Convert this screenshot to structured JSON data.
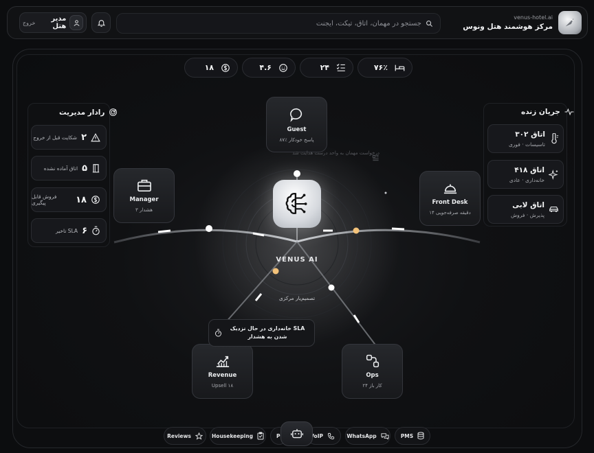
{
  "header": {
    "brand_sub": "venus-hotel.ai",
    "brand_title": "مرکز هوشمند هتل ونوس",
    "search_placeholder": "جستجو در مهمان، اتاق، تیکت، ایجنت",
    "user_name": "مدیر هتل",
    "logout_label": "خروج"
  },
  "stats": [
    {
      "value": "۷۶٪",
      "icon": "bed-icon"
    },
    {
      "value": "۲۴",
      "icon": "checklist-icon"
    },
    {
      "value": "۴.۶",
      "icon": "smile-icon"
    },
    {
      "value": "۱۸",
      "icon": "dollar-icon"
    }
  ],
  "radar": {
    "title": "رادار مدیریت",
    "items": [
      {
        "num": "۲",
        "label": "شکایت قبل از خروج",
        "icon": "warning-icon"
      },
      {
        "num": "۵",
        "label": "اتاق آماده نشده",
        "icon": "door-icon"
      },
      {
        "num": "۱۸",
        "label": "فروش قابل پیگیری",
        "icon": "dollar-icon"
      },
      {
        "num": "۶",
        "label": "تاخیر SLA",
        "icon": "timer-icon"
      }
    ]
  },
  "live": {
    "title": "جریان زنده",
    "items": [
      {
        "title": "اتاق ۳۰۲",
        "sub": "تاسیسات · فوری",
        "icon": "thermometer-icon"
      },
      {
        "title": "اتاق ۴۱۸",
        "sub": "خانه‌داری · عادی",
        "icon": "sparkle-icon"
      },
      {
        "title": "اتاق لابی",
        "sub": "پذیرش · فروش",
        "icon": "car-icon"
      }
    ]
  },
  "nodes": {
    "guest": {
      "name": "Guest",
      "sub": "۸۷٪ پاسخ خودکار"
    },
    "manager": {
      "name": "Manager",
      "sub": "۳ هشدار"
    },
    "frontdesk": {
      "name": "Front Desk",
      "sub": "۱۴ دقیقه صرفه‌جویی"
    },
    "revenue": {
      "name": "Revenue",
      "sub": "Upsell ۱۸"
    },
    "ops": {
      "name": "Ops",
      "sub": "۲۴ کار باز"
    }
  },
  "core": {
    "title": "VENUS AI",
    "subtitle": "تصمیم‌یار مرکزی",
    "ghost_text": "درخواست مهمان به واحد درست هدایت شد"
  },
  "alert": {
    "text": "SLA خانه‌داری در حال نزدیک شدن به هشدار"
  },
  "dock": {
    "reviews": "Reviews",
    "housekeeping": "Housekeeping",
    "pos": "PO",
    "voip": "VoIP",
    "whatsapp": "WhatsApp",
    "pms": "PMS"
  }
}
